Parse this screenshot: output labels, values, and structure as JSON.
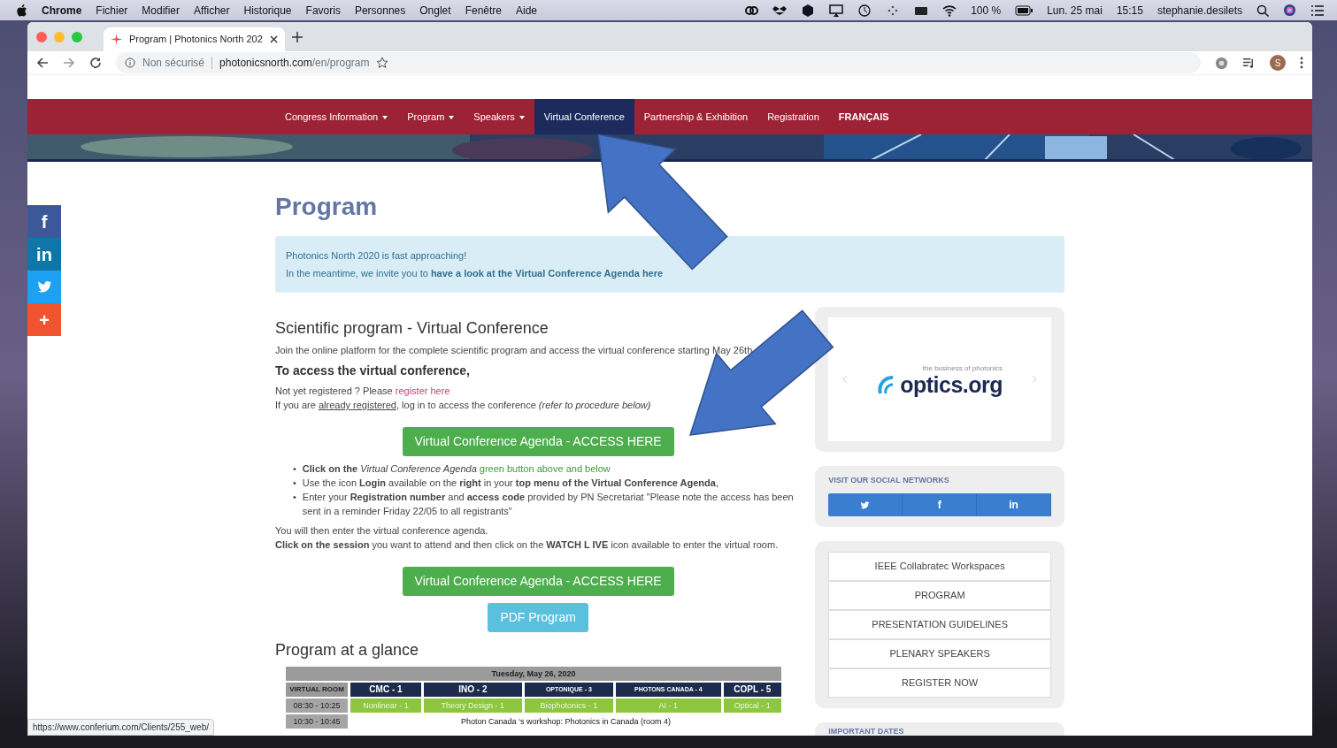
{
  "menubar": {
    "app": "Chrome",
    "menus": [
      "Fichier",
      "Modifier",
      "Afficher",
      "Historique",
      "Favoris",
      "Personnes",
      "Onglet",
      "Fenêtre",
      "Aide"
    ],
    "battery": "100 %",
    "date": "Lun. 25 mai",
    "time": "15:15",
    "user": "stephanie.desilets"
  },
  "browser": {
    "tabs": [
      {
        "title": "Program | Photonics North 202",
        "selected": true
      }
    ],
    "security": "Non sécurisé",
    "host": "photonicsnorth.com",
    "path": "/en/program",
    "profile": "S",
    "status_url": "https://www.conferium.com/Clients/255_web/"
  },
  "nav": [
    {
      "label": "Congress Information",
      "dropdown": true,
      "selected": false,
      "bold": false
    },
    {
      "label": "Program",
      "dropdown": true,
      "selected": false,
      "bold": false
    },
    {
      "label": "Speakers",
      "dropdown": true,
      "selected": false,
      "bold": false
    },
    {
      "label": "Virtual Conference",
      "dropdown": false,
      "selected": true,
      "bold": false
    },
    {
      "label": "Partnership & Exhibition",
      "dropdown": false,
      "selected": false,
      "bold": false
    },
    {
      "label": "Registration",
      "dropdown": false,
      "selected": false,
      "bold": false
    },
    {
      "label": "FRANÇAIS",
      "dropdown": false,
      "selected": false,
      "bold": true
    }
  ],
  "share": [
    {
      "kind": "facebook",
      "glyph": "f"
    },
    {
      "kind": "linkedin",
      "glyph": "in"
    },
    {
      "kind": "twitter"
    },
    {
      "kind": "more",
      "glyph": "+"
    }
  ],
  "page_title": "Program",
  "alert": [
    "Photonics North 2020 is fast approaching!",
    "In the meantime, we invite you to **have a look at the Virtual Conference Agenda here**"
  ],
  "section_title": "Scientific program - Virtual Conference",
  "intro": "Join the online platform for the complete scientific program and access the virtual conference starting May 26th",
  "access_heading": "To access the virtual conference,",
  "register_line": {
    "text": "Not yet registered ? Please ",
    "link": "register here"
  },
  "login_line": {
    "text": "If you are ",
    "link": "already registered",
    "rest": ", log in to access the conference *(refer to procedure below)*"
  },
  "agenda_button": {
    "label": "Virtual Conference Agenda - ACCESS HERE",
    "kind": "success"
  },
  "steps": [
    {
      "marker": "•",
      "text": "**Click on the** *Virtual Conference Agenda*",
      "highlight": " green button above and below"
    },
    {
      "marker": "•",
      "text": "Use the icon **Login** available on the **right** in your **top menu of the Virtual Conference Agenda**,"
    },
    {
      "marker": "•",
      "text": "Enter your **Registration number** and **access code** provided by PN Secretariat \"Please note the access has been sent in a reminder Friday 22/05 to all registrants\""
    }
  ],
  "after_steps": [
    "You will then enter the virtual conference agenda.",
    "**Click on the session** you want to attend and then click on the **WATCH L IVE** icon available to enter the virtual room."
  ],
  "bottom_buttons": [
    {
      "label": "Virtual Conference Agenda - ACCESS HERE",
      "kind": "success"
    },
    {
      "label": "PDF Program",
      "kind": "info"
    }
  ],
  "glance": {
    "title": "Program at a glance",
    "date": "Tuesday, May 26, 2020",
    "room_label": "VIRTUAL ROOM",
    "rooms": [
      "CMC - 1",
      "INO - 2",
      "OPTONIQUE - 3",
      "PHOTONS CANADA - 4",
      "COPL - 5"
    ],
    "rows": [
      {
        "time": "08:30 - 10:25",
        "kind": "sessions",
        "cells": [
          "Nonlinear - 1",
          "Theory Design - 1",
          "Biophotonics - 1",
          "AI - 1",
          "Optical - 1"
        ]
      },
      {
        "time": "10:30 - 10:45",
        "kind": "workshop",
        "text": "Photon Canada ‘s workshop: Photonics in Canada (room 4)"
      }
    ]
  },
  "sidebar": {
    "sponsor": {
      "tagline": "the business of photonics",
      "logo": "optics.org"
    },
    "social": {
      "title": "VISIT OUR SOCIAL NETWORKS",
      "links": [
        {
          "kind": "twitter"
        },
        {
          "kind": "facebook",
          "glyph": "f"
        },
        {
          "kind": "linkedin",
          "glyph": "in"
        }
      ]
    },
    "links": [
      "IEEE Collabratec Workspaces",
      "PROGRAM",
      "PRESENTATION GUIDELINES",
      "PLENARY SPEAKERS",
      "REGISTER NOW"
    ],
    "next_card_title": "IMPORTANT DATES"
  }
}
